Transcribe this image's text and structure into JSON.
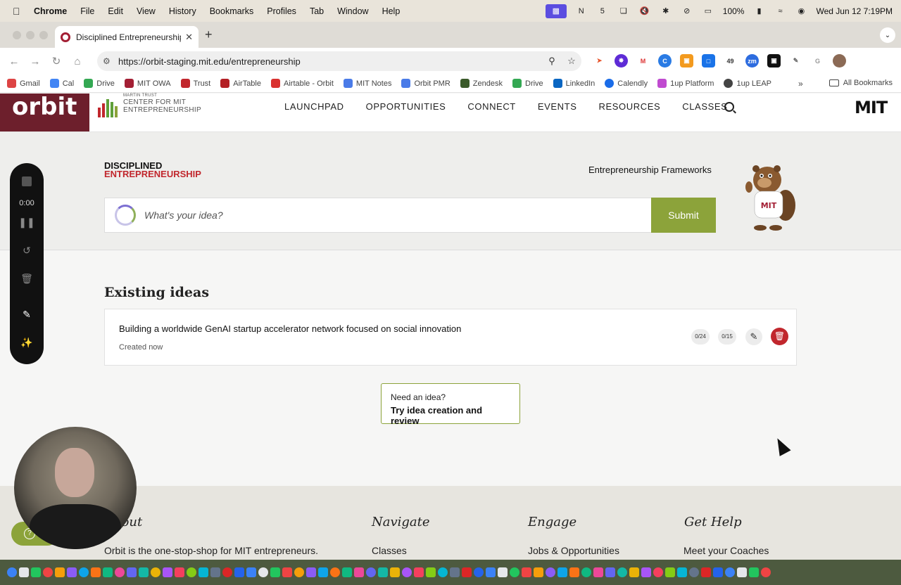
{
  "menubar": {
    "app": "Chrome",
    "items": [
      "File",
      "Edit",
      "View",
      "History",
      "Bookmarks",
      "Profiles",
      "Tab",
      "Window",
      "Help"
    ],
    "battery": "100%",
    "datetime": "Wed Jun 12  7:19PM"
  },
  "browser": {
    "tab_title": "Disciplined Entrepreneurship",
    "url": "https://orbit-staging.mit.edu/entrepreneurship",
    "extension_badge_1": "49"
  },
  "bookmarks": {
    "items": [
      "Gmail",
      "Cal",
      "Drive",
      "MIT OWA",
      "Trust",
      "AirTable",
      "Airtable - Orbit",
      "MIT Notes",
      "Orbit PMR",
      "Zendesk",
      "Drive",
      "LinkedIn",
      "Calendly",
      "1up Platform",
      "1up LEAP"
    ],
    "more": "»",
    "all": "All Bookmarks"
  },
  "header": {
    "logo": "orbit",
    "trust_lines": [
      "MARTIN TRUST",
      "CENTER FOR MIT",
      "ENTREPRENEURSHIP"
    ],
    "nav": [
      "LAUNCHPAD",
      "OPPORTUNITIES",
      "CONNECT",
      "EVENTS",
      "RESOURCES",
      "CLASSES"
    ],
    "mit_logo": "MIT"
  },
  "hero": {
    "logo_line1": "DISCIPLINED",
    "logo_line2": "ENTREPRENEURSHIP",
    "frameworks_link": "Entrepreneurship Frameworks",
    "idea_placeholder": "What's your idea?",
    "submit_label": "Submit"
  },
  "recorder": {
    "time": "0:00"
  },
  "ideas": {
    "section_title": "Existing ideas",
    "items": [
      {
        "title": "Building a worldwide GenAI startup accelerator network focused on social innovation",
        "created": "Created now",
        "count_a": "0/24",
        "count_b": "0/15"
      }
    ]
  },
  "need_idea": {
    "small": "Need an idea?",
    "big": "Try idea creation and review"
  },
  "footer": {
    "columns": [
      {
        "heading": "About",
        "first_line": "Orbit is the one-stop-shop for MIT entrepreneurs."
      },
      {
        "heading": "Navigate",
        "first_line": "Classes"
      },
      {
        "heading": "Engage",
        "first_line": "Jobs & Opportunities"
      },
      {
        "heading": "Get Help",
        "first_line": "Meet your Coaches"
      }
    ]
  },
  "colors": {
    "orbit_maroon": "#6d1f2c",
    "accent_green": "#8ca33a",
    "mit_red": "#c1272d"
  }
}
